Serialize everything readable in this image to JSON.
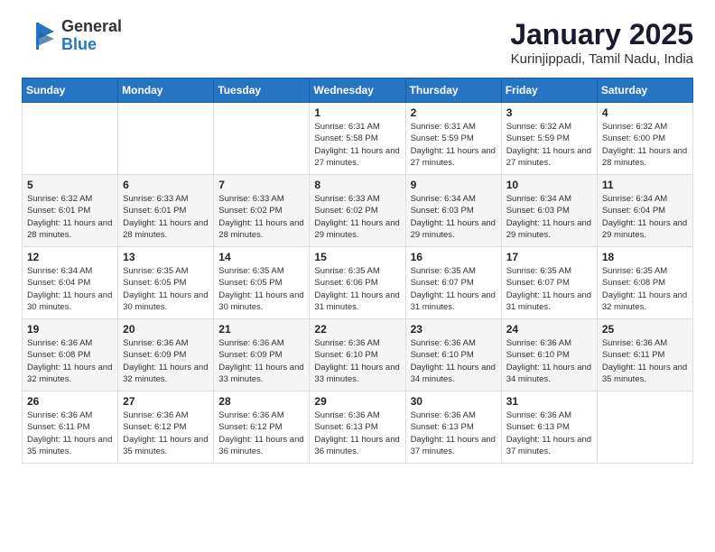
{
  "header": {
    "logo_general": "General",
    "logo_blue": "Blue",
    "month_title": "January 2025",
    "location": "Kurinjippadi, Tamil Nadu, India"
  },
  "weekdays": [
    "Sunday",
    "Monday",
    "Tuesday",
    "Wednesday",
    "Thursday",
    "Friday",
    "Saturday"
  ],
  "weeks": [
    [
      {
        "day": "",
        "info": ""
      },
      {
        "day": "",
        "info": ""
      },
      {
        "day": "",
        "info": ""
      },
      {
        "day": "1",
        "info": "Sunrise: 6:31 AM\nSunset: 5:58 PM\nDaylight: 11 hours\nand 27 minutes."
      },
      {
        "day": "2",
        "info": "Sunrise: 6:31 AM\nSunset: 5:59 PM\nDaylight: 11 hours\nand 27 minutes."
      },
      {
        "day": "3",
        "info": "Sunrise: 6:32 AM\nSunset: 5:59 PM\nDaylight: 11 hours\nand 27 minutes."
      },
      {
        "day": "4",
        "info": "Sunrise: 6:32 AM\nSunset: 6:00 PM\nDaylight: 11 hours\nand 28 minutes."
      }
    ],
    [
      {
        "day": "5",
        "info": "Sunrise: 6:32 AM\nSunset: 6:01 PM\nDaylight: 11 hours\nand 28 minutes."
      },
      {
        "day": "6",
        "info": "Sunrise: 6:33 AM\nSunset: 6:01 PM\nDaylight: 11 hours\nand 28 minutes."
      },
      {
        "day": "7",
        "info": "Sunrise: 6:33 AM\nSunset: 6:02 PM\nDaylight: 11 hours\nand 28 minutes."
      },
      {
        "day": "8",
        "info": "Sunrise: 6:33 AM\nSunset: 6:02 PM\nDaylight: 11 hours\nand 29 minutes."
      },
      {
        "day": "9",
        "info": "Sunrise: 6:34 AM\nSunset: 6:03 PM\nDaylight: 11 hours\nand 29 minutes."
      },
      {
        "day": "10",
        "info": "Sunrise: 6:34 AM\nSunset: 6:03 PM\nDaylight: 11 hours\nand 29 minutes."
      },
      {
        "day": "11",
        "info": "Sunrise: 6:34 AM\nSunset: 6:04 PM\nDaylight: 11 hours\nand 29 minutes."
      }
    ],
    [
      {
        "day": "12",
        "info": "Sunrise: 6:34 AM\nSunset: 6:04 PM\nDaylight: 11 hours\nand 30 minutes."
      },
      {
        "day": "13",
        "info": "Sunrise: 6:35 AM\nSunset: 6:05 PM\nDaylight: 11 hours\nand 30 minutes."
      },
      {
        "day": "14",
        "info": "Sunrise: 6:35 AM\nSunset: 6:05 PM\nDaylight: 11 hours\nand 30 minutes."
      },
      {
        "day": "15",
        "info": "Sunrise: 6:35 AM\nSunset: 6:06 PM\nDaylight: 11 hours\nand 31 minutes."
      },
      {
        "day": "16",
        "info": "Sunrise: 6:35 AM\nSunset: 6:07 PM\nDaylight: 11 hours\nand 31 minutes."
      },
      {
        "day": "17",
        "info": "Sunrise: 6:35 AM\nSunset: 6:07 PM\nDaylight: 11 hours\nand 31 minutes."
      },
      {
        "day": "18",
        "info": "Sunrise: 6:35 AM\nSunset: 6:08 PM\nDaylight: 11 hours\nand 32 minutes."
      }
    ],
    [
      {
        "day": "19",
        "info": "Sunrise: 6:36 AM\nSunset: 6:08 PM\nDaylight: 11 hours\nand 32 minutes."
      },
      {
        "day": "20",
        "info": "Sunrise: 6:36 AM\nSunset: 6:09 PM\nDaylight: 11 hours\nand 32 minutes."
      },
      {
        "day": "21",
        "info": "Sunrise: 6:36 AM\nSunset: 6:09 PM\nDaylight: 11 hours\nand 33 minutes."
      },
      {
        "day": "22",
        "info": "Sunrise: 6:36 AM\nSunset: 6:10 PM\nDaylight: 11 hours\nand 33 minutes."
      },
      {
        "day": "23",
        "info": "Sunrise: 6:36 AM\nSunset: 6:10 PM\nDaylight: 11 hours\nand 34 minutes."
      },
      {
        "day": "24",
        "info": "Sunrise: 6:36 AM\nSunset: 6:10 PM\nDaylight: 11 hours\nand 34 minutes."
      },
      {
        "day": "25",
        "info": "Sunrise: 6:36 AM\nSunset: 6:11 PM\nDaylight: 11 hours\nand 35 minutes."
      }
    ],
    [
      {
        "day": "26",
        "info": "Sunrise: 6:36 AM\nSunset: 6:11 PM\nDaylight: 11 hours\nand 35 minutes."
      },
      {
        "day": "27",
        "info": "Sunrise: 6:36 AM\nSunset: 6:12 PM\nDaylight: 11 hours\nand 35 minutes."
      },
      {
        "day": "28",
        "info": "Sunrise: 6:36 AM\nSunset: 6:12 PM\nDaylight: 11 hours\nand 36 minutes."
      },
      {
        "day": "29",
        "info": "Sunrise: 6:36 AM\nSunset: 6:13 PM\nDaylight: 11 hours\nand 36 minutes."
      },
      {
        "day": "30",
        "info": "Sunrise: 6:36 AM\nSunset: 6:13 PM\nDaylight: 11 hours\nand 37 minutes."
      },
      {
        "day": "31",
        "info": "Sunrise: 6:36 AM\nSunset: 6:13 PM\nDaylight: 11 hours\nand 37 minutes."
      },
      {
        "day": "",
        "info": ""
      }
    ]
  ]
}
